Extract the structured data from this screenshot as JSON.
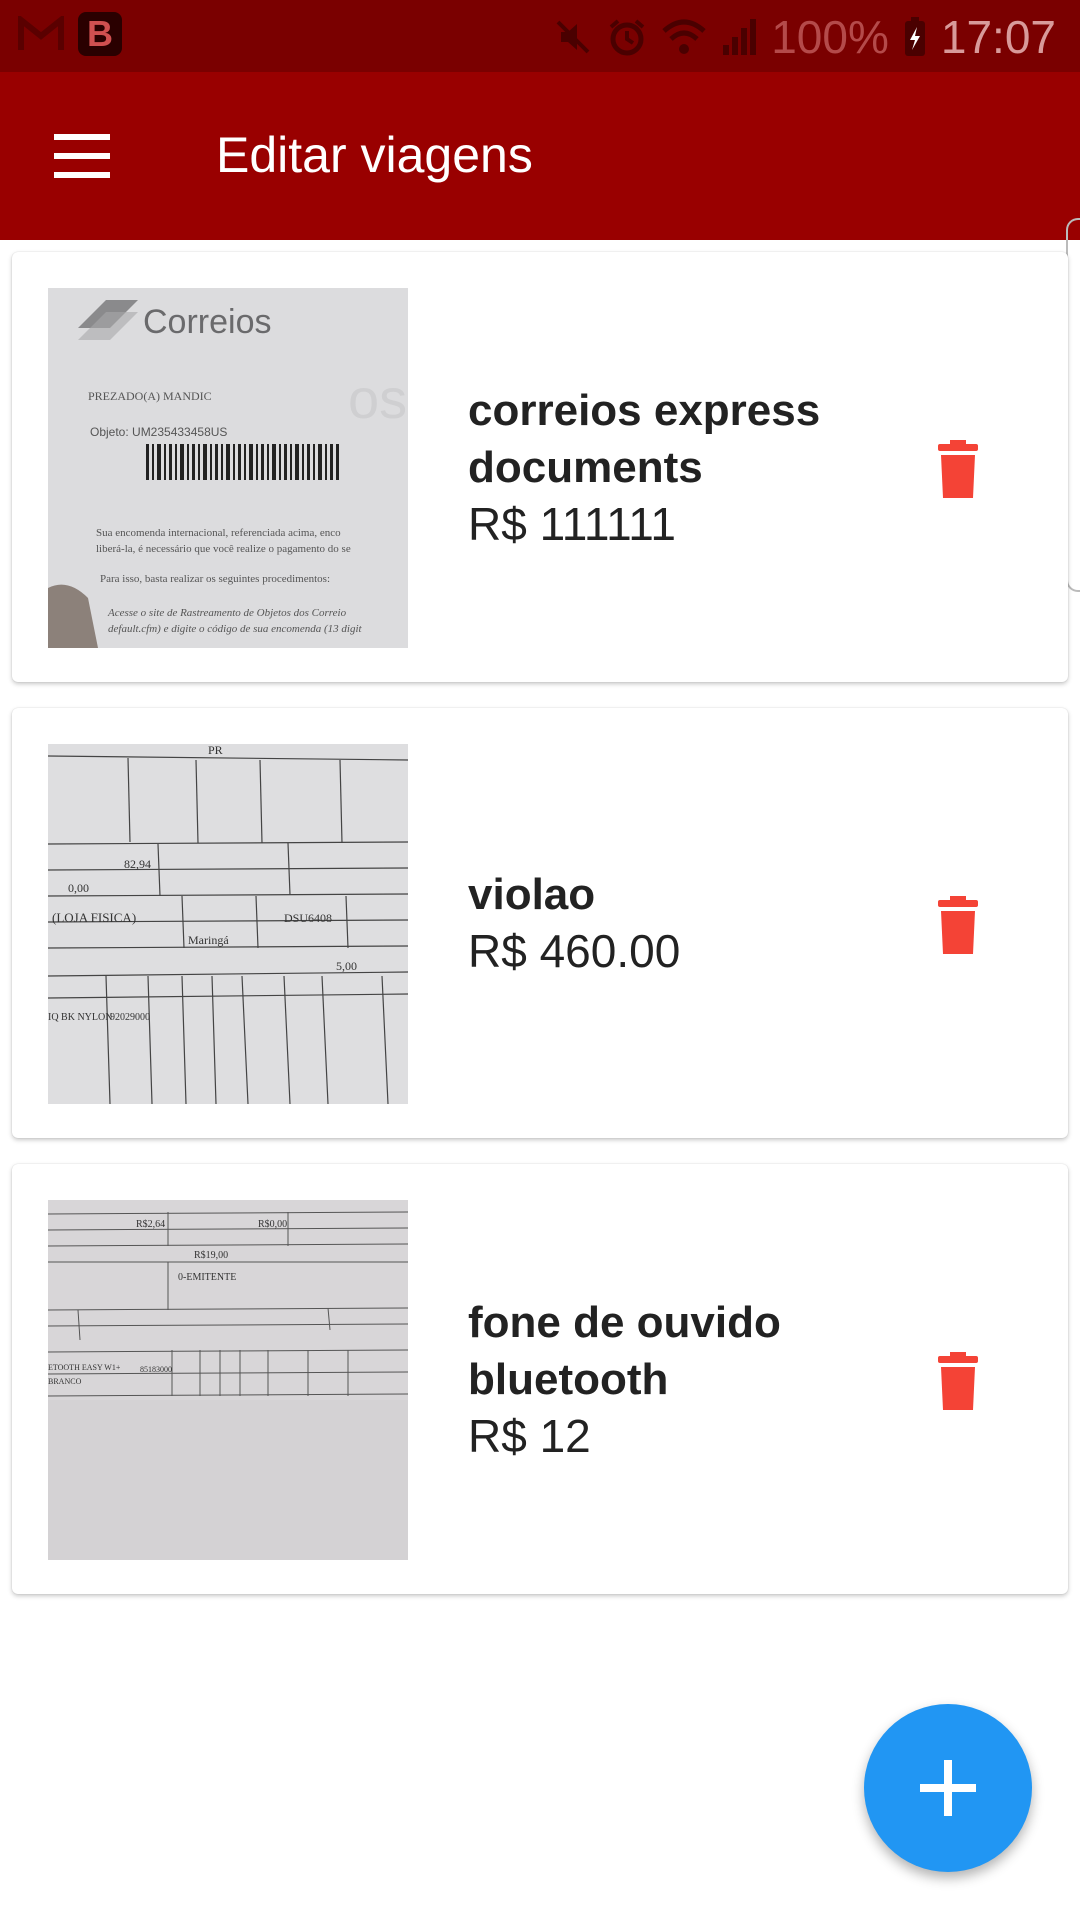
{
  "status_bar": {
    "left_icons": [
      "gmail-icon",
      "b-app-icon"
    ],
    "b_app_letter": "B",
    "right_icons": [
      "mute-icon",
      "alarm-icon",
      "wifi-icon",
      "signal-icon",
      "battery-charging-icon"
    ],
    "battery": "100%",
    "time": "17:07"
  },
  "app_bar": {
    "menu_icon": "hamburger-menu-icon",
    "title": "Editar viagens",
    "color": "#990000"
  },
  "items": [
    {
      "name": "correios express documents",
      "price": "R$ 111111",
      "thumbnail": "correios-receipt-photo",
      "thumbnail_text": {
        "brand": "Correios",
        "greeting": "PREZADO(A) MANDIC",
        "object": "Objeto: UM235433458US",
        "line1": "Sua encomenda internacional, referenciada acima, enco",
        "line2": "liberá-la, é necessário que você realize o pagamento do se",
        "line3": "Para isso, basta realizar os seguintes procedimentos:",
        "line4": "Acesse o site de Rastreamento de Objetos dos Correio",
        "line5": "default.cfm) e digite o código de sua encomenda (13 digit"
      },
      "delete_icon": "trash-icon"
    },
    {
      "name": "violao",
      "price": "R$ 460.00",
      "thumbnail": "invoice-photo",
      "thumbnail_text": {
        "a": "PR",
        "b": "82,94",
        "c": "0,00",
        "d": "(LOJA FISICA)",
        "e": "DSU6408",
        "f": "Maringá",
        "g": "5,00",
        "h": "IQ BK NYLON",
        "i": "92029000"
      },
      "delete_icon": "trash-icon"
    },
    {
      "name": "fone de ouvido bluetooth",
      "price": "R$ 12",
      "thumbnail": "invoice-photo",
      "thumbnail_text": {
        "a": "R$2,64",
        "b": "R$0,00",
        "c": "R$19,00",
        "d": "0-EMITENTE",
        "e": "ETOOTH EASY W1+",
        "f": "BRANCO",
        "g": "85183000"
      },
      "delete_icon": "trash-icon"
    }
  ],
  "fab": {
    "icon": "plus-icon",
    "color": "#2196f3"
  },
  "delete_color": "#f44336"
}
